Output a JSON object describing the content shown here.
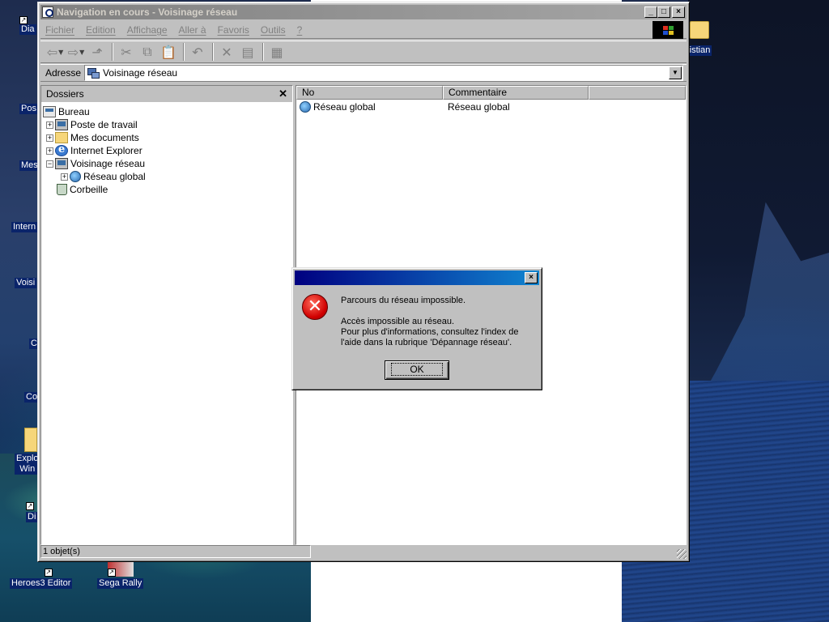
{
  "window": {
    "title": "Navigation en cours - Voisinage réseau",
    "controls": {
      "minimize": "_",
      "maximize": "□",
      "close": "×"
    },
    "menu": [
      "Fichier",
      "Edition",
      "Affichage",
      "Aller à",
      "Favoris",
      "Outils",
      "?"
    ],
    "address_label": "Adresse",
    "address_value": "Voisinage réseau",
    "folders_title": "Dossiers",
    "folders_close": "✕",
    "tree": [
      {
        "label": "Bureau",
        "icon": "desktop-icon"
      },
      {
        "label": "Poste de travail",
        "icon": "computer-icon",
        "expander": "+"
      },
      {
        "label": "Mes documents",
        "icon": "folder-icon",
        "expander": "+"
      },
      {
        "label": "Internet Explorer",
        "icon": "ie-icon",
        "expander": "+"
      },
      {
        "label": "Voisinage réseau",
        "icon": "network-icon",
        "expander": "−"
      },
      {
        "label": "Réseau global",
        "icon": "globe-icon",
        "expander": "+"
      },
      {
        "label": "Corbeille",
        "icon": "recycle-bin-icon"
      }
    ],
    "columns": [
      "No",
      "Commentaire"
    ],
    "rows": [
      {
        "name": "Réseau global",
        "comment": "Réseau global"
      }
    ],
    "status": "1 objet(s)"
  },
  "dialog": {
    "close": "×",
    "line1": "Parcours du réseau impossible.",
    "line2": "Accès impossible au réseau.",
    "line3": "Pour plus d'informations, consultez l'index de l'aide dans la rubrique 'Dépannage réseau'.",
    "ok": "OK"
  },
  "desktop_icons": [
    {
      "label": "Dia"
    },
    {
      "label": "Pos"
    },
    {
      "label": "Mes"
    },
    {
      "label": "Intern"
    },
    {
      "label": "Voisi"
    },
    {
      "label": "C"
    },
    {
      "label": "Co"
    },
    {
      "label": "Explo Win"
    },
    {
      "label": "Di"
    },
    {
      "label": "Heroes3 Editor"
    },
    {
      "label": "Sega Rally"
    },
    {
      "label": "ristian"
    }
  ],
  "colors": {
    "dialog_title_from": "#000080",
    "dialog_title_to": "#1084d0",
    "error_red": "#d00000",
    "selection": "#0a246a"
  }
}
